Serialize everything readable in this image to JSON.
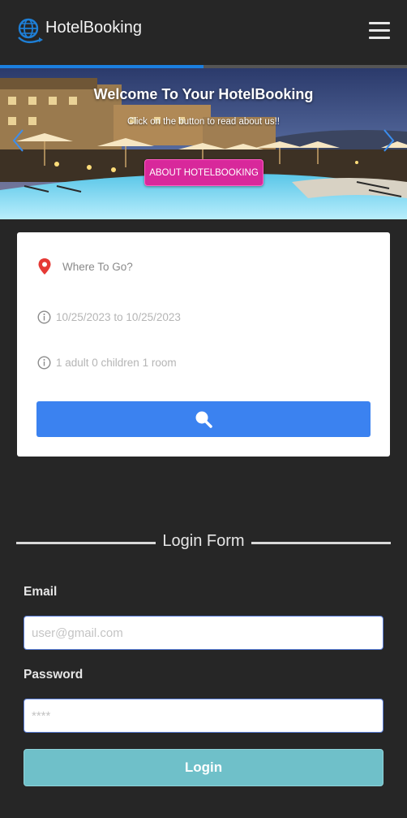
{
  "navbar": {
    "brand_name": "HotelBooking",
    "logo_icon": "globe-logo-icon",
    "menu_icon": "hamburger-menu-icon"
  },
  "carousel": {
    "progress_fraction": 0.5,
    "title": "Welcome To Your HotelBooking",
    "subtitle": "Click on the button to read about us!!",
    "button_label": "ABOUT HOTELBOOKING",
    "prev_icon": "chevron-left-icon",
    "next_icon": "chevron-right-icon"
  },
  "search": {
    "destination_placeholder": "Where To Go?",
    "destination_icon": "map-pin-icon",
    "dates": "10/25/2023 to 10/25/2023",
    "guests": "1 adult 0 children 1 room",
    "info_icon": "info-circle-icon",
    "search_icon": "search-icon"
  },
  "login": {
    "heading": "Login Form",
    "email_label": "Email",
    "email_placeholder": "user@gmail.com",
    "password_label": "Password",
    "password_placeholder": "****",
    "button_label": "Login"
  },
  "colors": {
    "background": "#262626",
    "accent_blue": "#3b82f0",
    "about_button": "#d8289b",
    "login_button": "#6fc0c9",
    "pin_red": "#e53935"
  }
}
